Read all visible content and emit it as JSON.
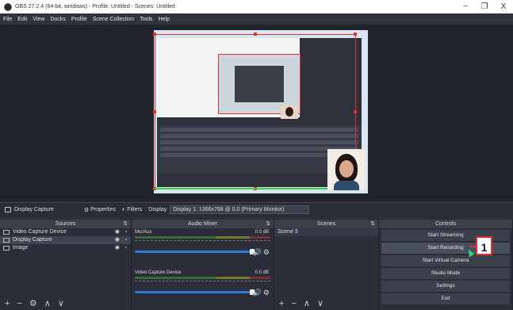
{
  "window": {
    "title": "OBS 27.2.4 (64-bit, windows) - Profile: Untitled - Scenes: Untitled",
    "minimize": "−",
    "maximize": "❐",
    "close": "X"
  },
  "menu": [
    "File",
    "Edit",
    "View",
    "Docks",
    "Profile",
    "Scene Collection",
    "Tools",
    "Help"
  ],
  "source_toolbar": {
    "selected_source": "Display Capture",
    "properties": "Properties",
    "filters": "Filters",
    "display_label": "Display",
    "display_value": "Display 1: 1366x768 @ 0,0 (Primary Monitor)"
  },
  "sources": {
    "header": "Sources",
    "items": [
      "Video Capture Device",
      "Display Capture",
      "Image"
    ]
  },
  "mixer": {
    "header": "Audio Mixer",
    "channels": [
      {
        "name": "Mic/Aux",
        "db": "0.0 dB"
      },
      {
        "name": "Video Capture Device",
        "db": "0.0 dB"
      }
    ]
  },
  "scenes": {
    "header": "Scenes",
    "items": [
      "Scene 3"
    ]
  },
  "controls": {
    "header": "Controls",
    "buttons": [
      "Start Streaming",
      "Start Recording",
      "Start Virtual Camera",
      "Studio Mode",
      "Settings",
      "Exit"
    ]
  },
  "callout": "1"
}
